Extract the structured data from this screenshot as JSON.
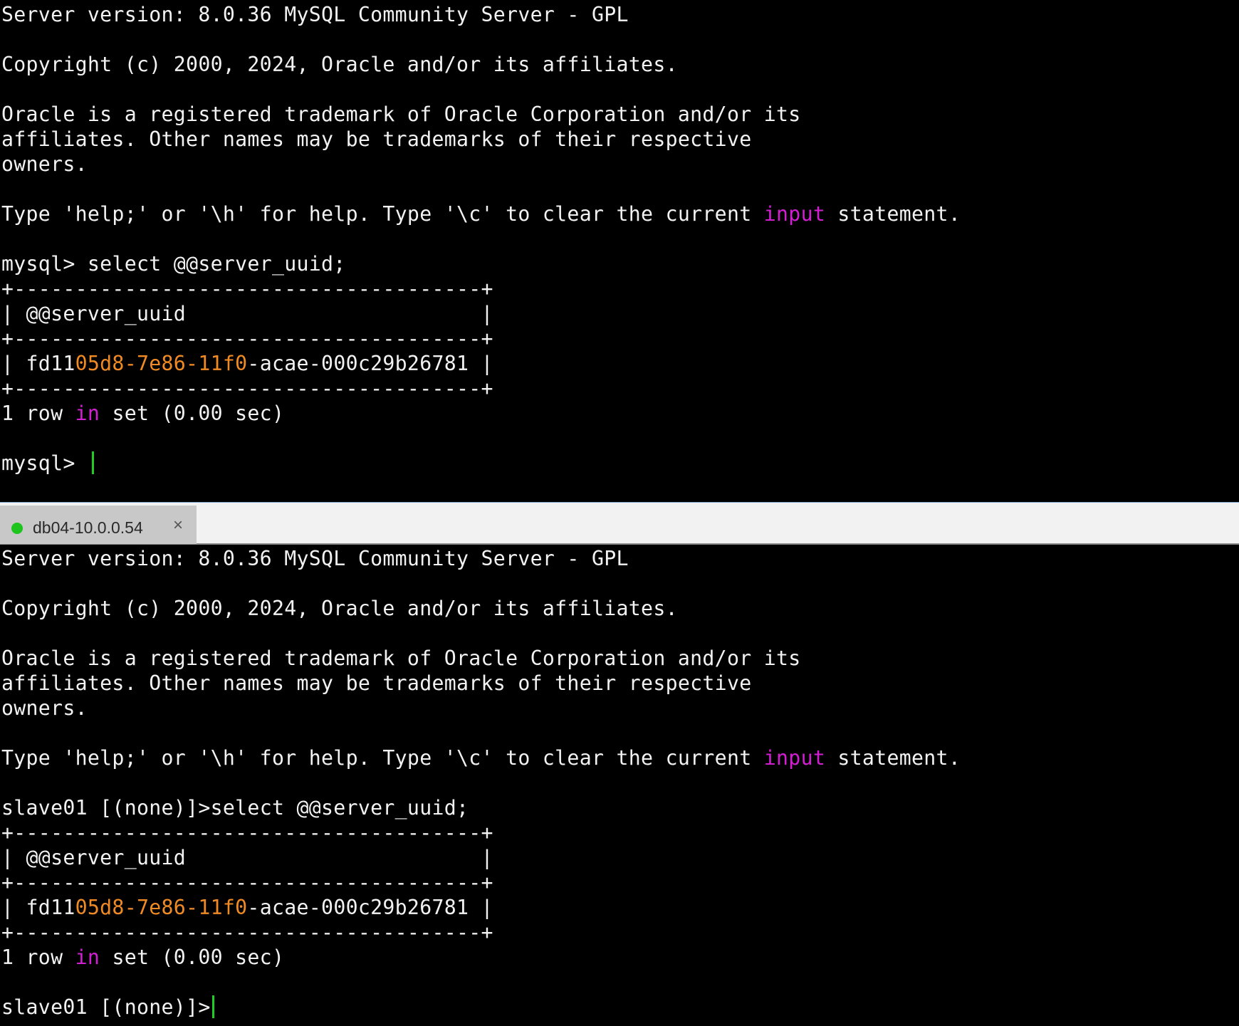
{
  "colors": {
    "background": "#000000",
    "text": "#f2f2f2",
    "keyword": "#d41ed4",
    "uuid_highlight": "#f08a24",
    "cursor": "#22cc22",
    "tab_status": "#1ec41e"
  },
  "top_pane": {
    "server_version": "Server version: 8.0.36 MySQL Community Server - GPL",
    "copyright": "Copyright (c) 2000, 2024, Oracle and/or its affiliates.",
    "trademark_1": "Oracle is a registered trademark of Oracle Corporation and/or its",
    "trademark_2": "affiliates. Other names may be trademarks of their respective",
    "trademark_3": "owners.",
    "help_pre": "Type 'help;' or '\\h' for help. Type '\\c' to clear the current ",
    "help_keyword": "input",
    "help_post": " statement.",
    "query_prompt": "mysql> ",
    "query": "select @@server_uuid;",
    "border": "+--------------------------------------+",
    "header_row": "| @@server_uuid                        |",
    "value_pre": "| fd11",
    "value_hl": "05d8-7e86-11f0",
    "value_post": "-acae-000c29b26781 |",
    "result_pre": "1 row ",
    "result_keyword": "in",
    "result_post": " set (0.00 sec)",
    "final_prompt": "mysql> "
  },
  "tab": {
    "label": "db04-10.0.0.54",
    "close_icon": "×"
  },
  "bottom_pane": {
    "server_version": "Server version: 8.0.36 MySQL Community Server - GPL",
    "copyright": "Copyright (c) 2000, 2024, Oracle and/or its affiliates.",
    "trademark_1": "Oracle is a registered trademark of Oracle Corporation and/or its",
    "trademark_2": "affiliates. Other names may be trademarks of their respective",
    "trademark_3": "owners.",
    "help_pre": "Type 'help;' or '\\h' for help. Type '\\c' to clear the current ",
    "help_keyword": "input",
    "help_post": " statement.",
    "query_prompt": "slave01 [(none)]>",
    "query": "select @@server_uuid;",
    "border": "+--------------------------------------+",
    "header_row": "| @@server_uuid                        |",
    "value_pre": "| fd11",
    "value_hl": "05d8-7e86-11f0",
    "value_post": "-acae-000c29b26781 |",
    "result_pre": "1 row ",
    "result_keyword": "in",
    "result_post": " set (0.00 sec)",
    "final_prompt": "slave01 [(none)]>"
  }
}
